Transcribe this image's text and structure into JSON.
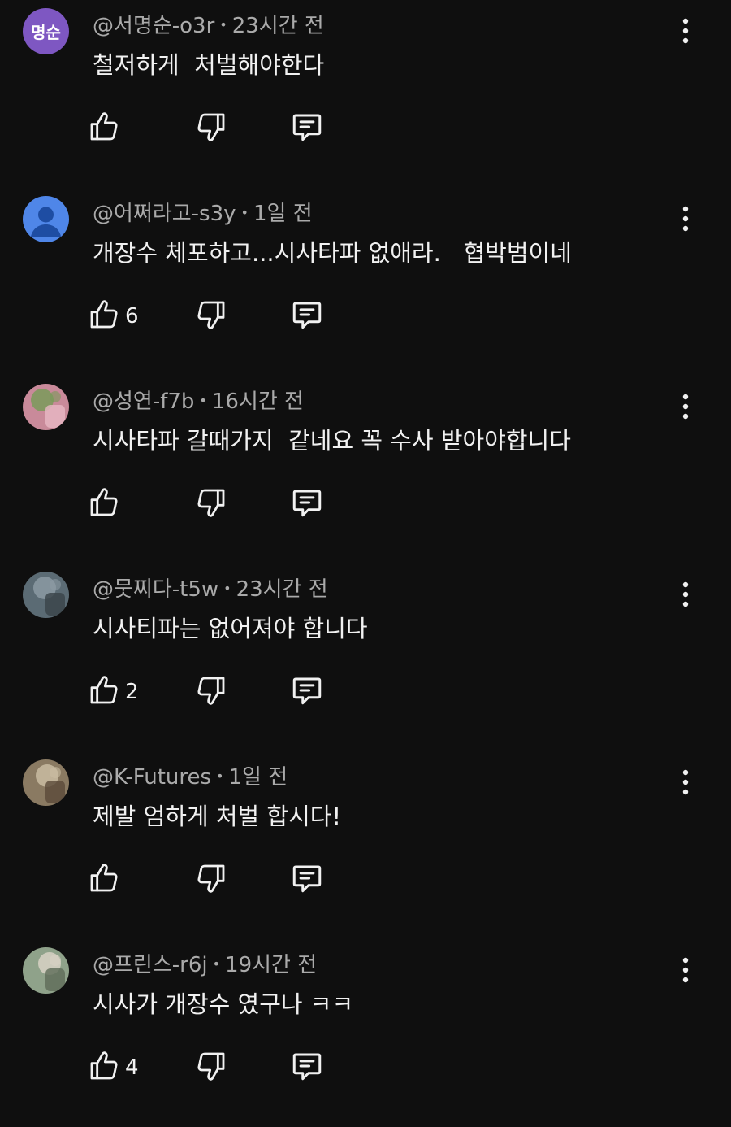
{
  "comments": [
    {
      "author": "@서명순-o3r",
      "time": "23시간 전",
      "text": "철저하게  처벌해야한다",
      "likes": "",
      "avatar": {
        "type": "initials",
        "initials": "명순",
        "color": "#7e57c2"
      }
    },
    {
      "author": "@어쩌라고-s3y",
      "time": "1일 전",
      "text": "개장수 체포하고...시사타파 없애라.   협박범이네",
      "likes": "6",
      "avatar": {
        "type": "default",
        "color": "#4f86e8"
      }
    },
    {
      "author": "@성연-f7b",
      "time": "16시간 전",
      "text": "시사타파 갈때가지  같네요 꼭 수사 받아야합니다",
      "likes": "",
      "avatar": {
        "type": "photo",
        "colors": [
          "#c98a9a",
          "#7a9a5a",
          "#e9b8c4"
        ]
      }
    },
    {
      "author": "@뭇찌다-t5w",
      "time": "23시간 전",
      "text": "시사티파는 없어져야 합니다",
      "likes": "2",
      "avatar": {
        "type": "photo",
        "colors": [
          "#5b6b74",
          "#8c9aa3",
          "#3a4348"
        ]
      }
    },
    {
      "author": "@K-Futures",
      "time": "1일 전",
      "text": "제발 엄하게 처벌 합시다!",
      "likes": "",
      "avatar": {
        "type": "photo",
        "colors": [
          "#8a7a62",
          "#c9bca2",
          "#5a4a3a"
        ]
      }
    },
    {
      "author": "@프린스-r6j",
      "time": "19시간 전",
      "text": "시사가 개장수 였구나 ㅋㅋ",
      "likes": "4",
      "avatar": {
        "type": "photo",
        "colors": [
          "#8fa28a",
          "#d8d2c4",
          "#5e6b58"
        ]
      }
    }
  ],
  "icons": {
    "like": "thumb-up-icon",
    "dislike": "thumb-down-icon",
    "reply": "comment-reply-icon",
    "more": "more-vertical-icon"
  }
}
